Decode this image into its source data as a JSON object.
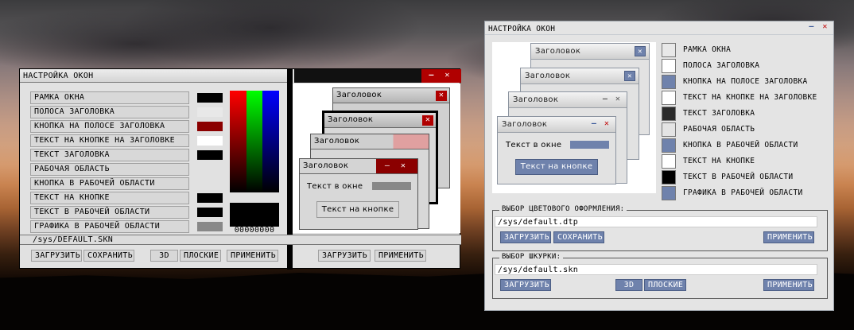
{
  "left": {
    "title": "НАСТРОЙКА ОКОН",
    "items": [
      {
        "label": "РАМКА ОКНА",
        "color": "#000000"
      },
      {
        "label": "ПОЛОСА ЗАГОЛОВКА",
        "color": "#e8e8e8"
      },
      {
        "label": "КНОПКА НА ПОЛОСЕ ЗАГОЛОВКА",
        "color": "#8b0000"
      },
      {
        "label": "ТЕКСТ НА КНОПКЕ НА ЗАГОЛОВКЕ",
        "color": "#ffffff"
      },
      {
        "label": "ТЕКСТ ЗАГОЛОВКА",
        "color": "#000000"
      },
      {
        "label": "РАБОЧАЯ ОБЛАСТЬ",
        "color": ""
      },
      {
        "label": "КНОПКА В РАБОЧЕЙ ОБЛАСТИ",
        "color": ""
      },
      {
        "label": "ТЕКСТ НА КНОПКЕ",
        "color": "#000000"
      },
      {
        "label": "ТЕКСТ В РАБОЧЕЙ ОБЛАСТИ",
        "color": "#000000"
      },
      {
        "label": "ГРАФИКА В РАБОЧЕЙ ОБЛАСТИ",
        "color": "#888888"
      }
    ],
    "color_value": "00000000",
    "path": "/sys/DEFAULT.SKN",
    "buttons": {
      "load": "ЗАГРУЗИТЬ",
      "save": "СОХРАНИТЬ",
      "d3": "3D",
      "flat": "ПЛОСКИЕ",
      "apply": "ПРИМЕНИТЬ",
      "load2": "ЗАГРУЗИТЬ",
      "apply2": "ПРИМЕНИТЬ"
    },
    "minimize_glyph": "–",
    "close_glyph": "✕",
    "preview": {
      "title": "Заголовок",
      "text": "Текст в окне",
      "button": "Текст на кнопке"
    }
  },
  "right": {
    "title": "НАСТРОЙКА ОКОН",
    "minimize_glyph": "–",
    "close_glyph": "✕",
    "preview": {
      "title": "Заголовок",
      "text": "Текст в окне",
      "button": "Текст на кнопке"
    },
    "items": [
      {
        "label": "РАМКА ОКНА",
        "color": "#e8e8e8"
      },
      {
        "label": "ПОЛОСА ЗАГОЛОВКА",
        "color": "#ffffff"
      },
      {
        "label": "КНОПКА НА ПОЛОСЕ ЗАГОЛОВКА",
        "color": "#6f82ac"
      },
      {
        "label": "ТЕКСТ НА КНОПКЕ НА ЗАГОЛОВКЕ",
        "color": "#ffffff"
      },
      {
        "label": "ТЕКСТ ЗАГОЛОВКА",
        "color": "#2a2a2a"
      },
      {
        "label": "РАБОЧАЯ ОБЛАСТЬ",
        "color": "#e4e4e4"
      },
      {
        "label": "КНОПКА В РАБОЧЕЙ ОБЛАСТИ",
        "color": "#6f82ac"
      },
      {
        "label": "ТЕКСТ НА КНОПКЕ",
        "color": "#ffffff"
      },
      {
        "label": "ТЕКСТ В РАБОЧЕЙ ОБЛАСТИ",
        "color": "#000000"
      },
      {
        "label": "ГРАФИКА В РАБОЧЕЙ ОБЛАСТИ",
        "color": "#6f82ac"
      }
    ],
    "theme_group": {
      "title": "ВЫБОР ЦВЕТОВОГО ОФОРМЛЕНИЯ:",
      "path": "/sys/default.dtp",
      "load": "ЗАГРУЗИТЬ",
      "save": "СОХРАНИТЬ",
      "apply": "ПРИМЕНИТЬ"
    },
    "skin_group": {
      "title": "ВЫБОР ШКУРКИ:",
      "path": "/sys/default.skn",
      "load": "ЗАГРУЗИТЬ",
      "d3": "3D",
      "flat": "ПЛОСКИЕ",
      "apply": "ПРИМЕНИТЬ"
    }
  }
}
